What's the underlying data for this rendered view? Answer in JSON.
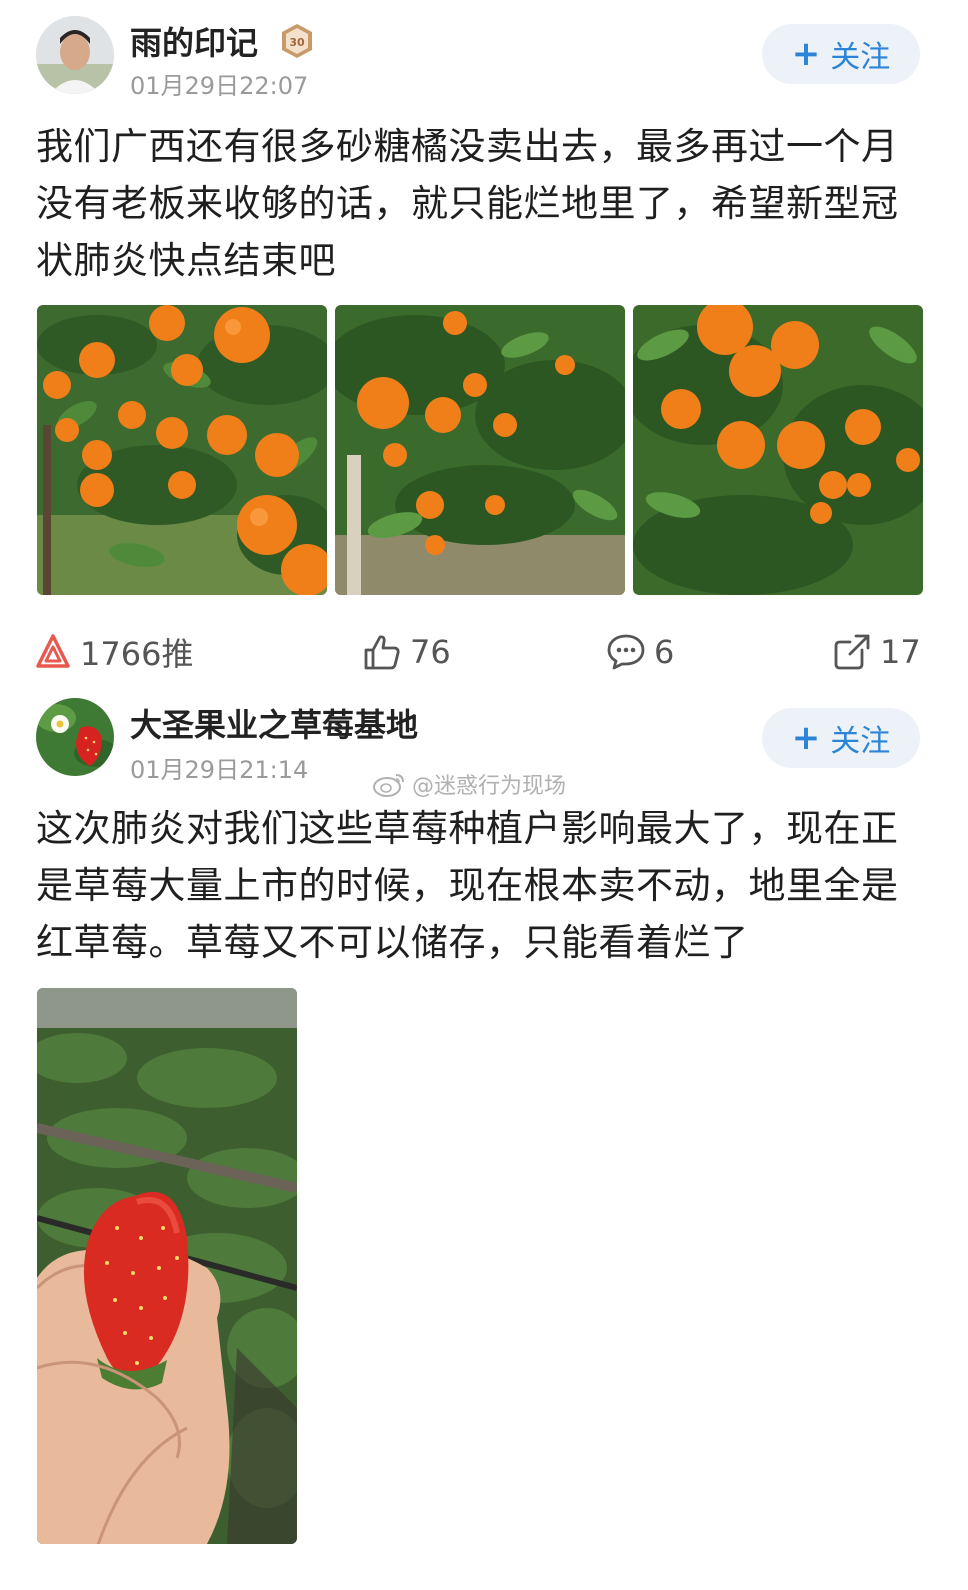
{
  "posts": [
    {
      "user": "雨的印记",
      "level_badge": "30",
      "time": "01月29日22:07",
      "follow_label": "关注",
      "text": "我们广西还有很多砂糖橘没卖出去，最多再过一个月没有老板来收够的话，就只能烂地里了，希望新型冠状肺炎快点结束吧",
      "images": [
        "orange-tree-photo",
        "orange-tree-photo",
        "orange-tree-photo"
      ],
      "actions": {
        "tui": "1766推",
        "likes": "76",
        "comments": "6",
        "shares": "17"
      }
    },
    {
      "user": "大圣果业之草莓基地",
      "time": "01月29日21:14",
      "follow_label": "关注",
      "text": "这次肺炎对我们这些草莓种植户影响最大了，现在正是草莓大量上市的时候，现在根本卖不动，地里全是红草莓。草莓又不可以储存，只能看着烂了",
      "images": [
        "strawberry-photo"
      ]
    }
  ],
  "watermark": "@迷惑行为现场",
  "colors": {
    "follow_text": "#2c84d6",
    "follow_bg": "#edf2f8",
    "time": "#9a9a9a",
    "tui_icon": "#e8584f"
  }
}
